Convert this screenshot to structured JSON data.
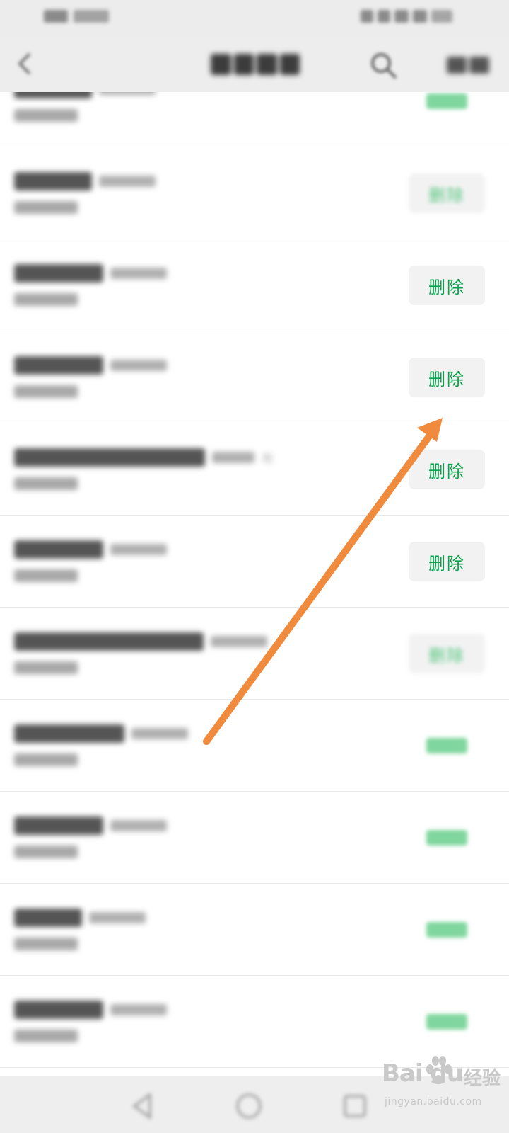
{
  "list": {
    "delete_label": "删除",
    "rows": [
      {
        "state": "green-pill"
      },
      {
        "state": "soft"
      },
      {
        "state": "clear"
      },
      {
        "state": "clear"
      },
      {
        "state": "clear",
        "tag": "用"
      },
      {
        "state": "clear"
      },
      {
        "state": "soft"
      },
      {
        "state": "green-pill"
      },
      {
        "state": "green-pill"
      },
      {
        "state": "green-pill"
      },
      {
        "state": "green-pill"
      }
    ]
  },
  "watermark": {
    "brand": "Bai du",
    "suffix": "经验",
    "url": "jingyan.baidu.com"
  },
  "colors": {
    "accent_green": "#07a34a",
    "annotation_arrow": "#f08a3c"
  },
  "icons": {
    "nav_back": "chevron-left-icon",
    "nav_search": "search-icon",
    "sys_back": "triangle-back-icon",
    "sys_home": "circle-home-icon",
    "sys_recent": "square-recent-icon"
  }
}
